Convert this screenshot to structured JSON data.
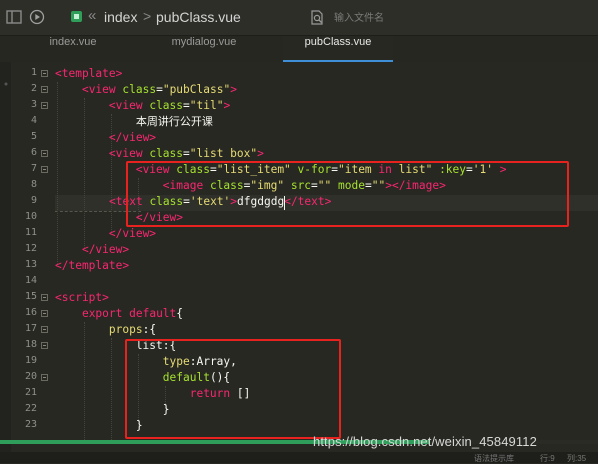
{
  "header": {
    "breadcrumb": {
      "back_glyph": "«",
      "project": "index",
      "separator": ">",
      "file": "pubClass.vue"
    },
    "search_placeholder": "输入文件名"
  },
  "tabs": [
    {
      "label": "index.vue",
      "active": false
    },
    {
      "label": "mydialog.vue",
      "active": false
    },
    {
      "label": "pubClass.vue",
      "active": true
    }
  ],
  "editor": {
    "line_numbers": [
      "1",
      "2",
      "3",
      "4",
      "5",
      "6",
      "7",
      "8",
      "9",
      "10",
      "11",
      "12",
      "13",
      "14",
      "15",
      "16",
      "17",
      "18",
      "19",
      "20",
      "21",
      "22",
      "23"
    ],
    "lines": [
      {
        "n": "1",
        "html": "<span class=\"tag\">&lt;template&gt;</span>"
      },
      {
        "n": "2",
        "html": "    <span class=\"tag\">&lt;view</span> <span class=\"attr\">class</span>=<span class=\"str\">\"pubClass\"</span><span class=\"tag\">&gt;</span>"
      },
      {
        "n": "3",
        "html": "        <span class=\"tag\">&lt;view</span> <span class=\"attr\">class</span>=<span class=\"str\">\"til\"</span><span class=\"tag\">&gt;</span>"
      },
      {
        "n": "4",
        "html": "            <span class=\"plain cjk\">本周讲行公开课</span>"
      },
      {
        "n": "5",
        "html": "        <span class=\"tag\">&lt;/view&gt;</span>"
      },
      {
        "n": "6",
        "html": "        <span class=\"tag\">&lt;view</span> <span class=\"attr\">class</span>=<span class=\"str\">\"list box\"</span><span class=\"tag\">&gt;</span>"
      },
      {
        "n": "7",
        "html": "            <span class=\"tag\">&lt;view</span> <span class=\"attr\">class</span>=<span class=\"str\">\"list_item\"</span> <span class=\"attr\">v-for</span>=<span class=\"str\">\"item </span><span class=\"kw\">in</span><span class=\"str\"> list\"</span> <span class=\"attr\">:key</span>=<span class=\"str\">'1'</span> <span class=\"tag\">&gt;</span>"
      },
      {
        "n": "8",
        "html": "                <span class=\"tag\">&lt;image</span> <span class=\"attr\">class</span>=<span class=\"str\">\"img\"</span> <span class=\"attr\">src</span>=<span class=\"str\">\"\"</span> <span class=\"attr\">mode</span>=<span class=\"str\">\"\"</span><span class=\"tag\">&gt;&lt;/image&gt;</span>"
      },
      {
        "n": "9",
        "html": "            <span class=\"tag\">&lt;text</span> <span class=\"attr\">class</span>=<span class=\"str\">'text'</span><span class=\"tag\">&gt;</span>dfgdgdg<span class=\"tag\">&lt;/text&gt;</span>"
      },
      {
        "n": "10",
        "html": "            <span class=\"tag\">&lt;/view&gt;</span>"
      },
      {
        "n": "11",
        "html": "        <span class=\"tag\">&lt;/view&gt;</span>"
      },
      {
        "n": "12",
        "html": "    <span class=\"tag\">&lt;/view&gt;</span>"
      },
      {
        "n": "13",
        "html": "<span class=\"tag\">&lt;/template&gt;</span>"
      },
      {
        "n": "14",
        "html": ""
      },
      {
        "n": "15",
        "html": "<span class=\"tag\">&lt;script&gt;</span>"
      },
      {
        "n": "16",
        "html": "    <span class=\"kw\">export</span> <span class=\"kw\">default</span>{"
      },
      {
        "n": "17",
        "html": "        <span class=\"str\">props</span>:{"
      },
      {
        "n": "18",
        "html": "            list:{"
      },
      {
        "n": "19",
        "html": "                <span class=\"str\">type</span>:Array,"
      },
      {
        "n": "20",
        "html": "                <span class=\"fn\">default</span>(){"
      },
      {
        "n": "21",
        "html": "                    <span class=\"kw\">return</span> []"
      },
      {
        "n": "22",
        "html": "                }"
      },
      {
        "n": "23",
        "html": "            }"
      }
    ]
  },
  "watermark": "https://blog.csdn.net/weixin_45849112",
  "status": {
    "syntax": "语法提示库",
    "row": "行:9",
    "col": "列:35"
  },
  "colors": {
    "highlight_box": "#e8231f",
    "accent_tab": "#3f8fd8",
    "scroll_thumb": "#2e9e5a"
  }
}
